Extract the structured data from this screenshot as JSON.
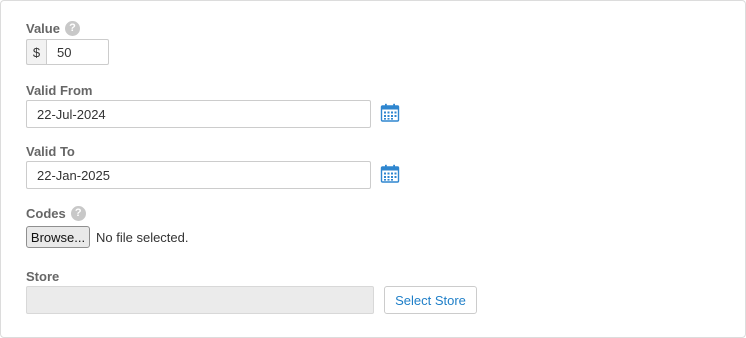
{
  "value": {
    "label": "Value",
    "currency_symbol": "$",
    "amount": "50",
    "help_icon_glyph": "?"
  },
  "valid_from": {
    "label": "Valid From",
    "date": "22-Jul-2024",
    "icon": "calendar-icon"
  },
  "valid_to": {
    "label": "Valid To",
    "date": "22-Jan-2025",
    "icon": "calendar-icon"
  },
  "codes": {
    "label": "Codes",
    "help_icon_glyph": "?",
    "browse_label": "Browse...",
    "file_status": "No file selected."
  },
  "store": {
    "label": "Store",
    "value": "",
    "select_label": "Select Store"
  },
  "colors": {
    "accent": "#1f7fc8",
    "label": "#666666",
    "border": "#cccccc",
    "disabled_bg": "#ebebeb"
  }
}
